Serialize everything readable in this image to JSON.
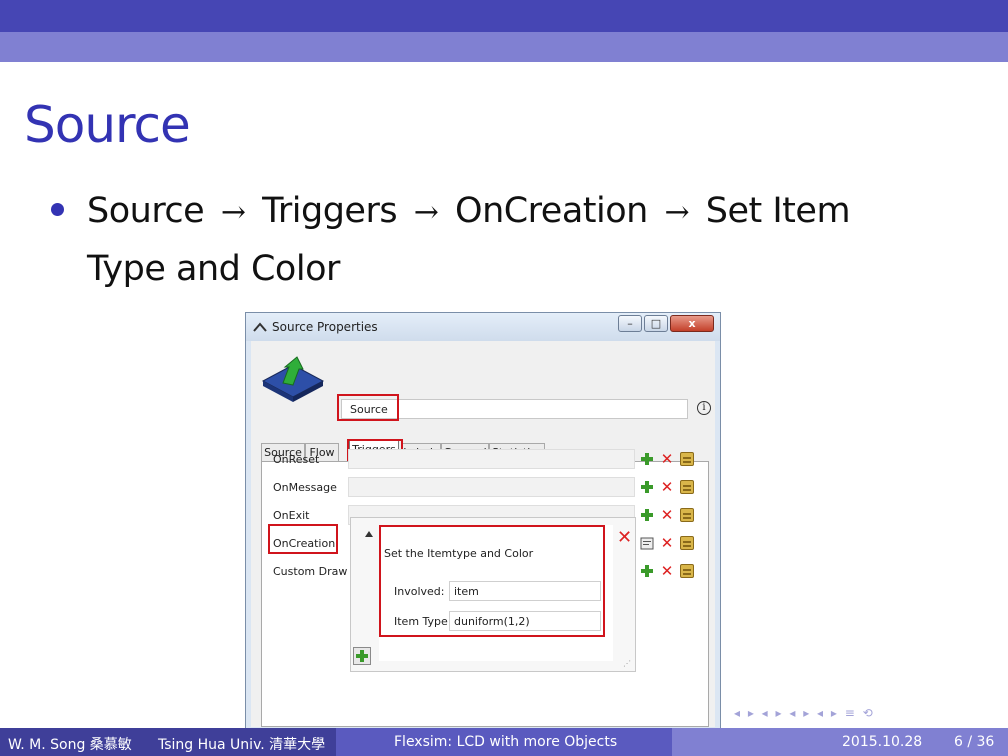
{
  "slide": {
    "title": "Source",
    "bullet": {
      "part1": "Source",
      "part2": "Triggers",
      "part3": "OnCreation",
      "part4": "Set Item",
      "part5": "Type and Color",
      "arrow": "→"
    }
  },
  "window": {
    "title": "Source  Properties",
    "controls": {
      "minimize": "–",
      "maximize": "□",
      "close": "x"
    },
    "name_value": "Source",
    "info": "i",
    "tabs": [
      "Source",
      "Flow",
      "Triggers",
      "Labels",
      "General",
      "Statistics"
    ],
    "active_tab": "Triggers",
    "triggers": [
      "OnReset",
      "OnMessage",
      "OnExit",
      "OnCreation",
      "Custom Draw"
    ],
    "code": {
      "title": "Set the Itemtype and Color",
      "involved_label": "Involved:",
      "involved_value": "item",
      "itemtype_label": "Item Type:",
      "itemtype_value": "duniform(1,2)"
    }
  },
  "nav_symbols": "◂ ▸ ◂ ▸ ◂ ▸ ◂ ▸ ≡ ⟲",
  "footer": {
    "author": "W. M. Song 桑慕敏",
    "institute": "Tsing Hua Univ. 清華大學",
    "subject": "Flexsim: LCD with more Objects",
    "date": "2015.10.28",
    "page": "6 / 36"
  },
  "colors": {
    "title": "#3333b3",
    "highlight": "#d0141c",
    "topbar_dark": "#4646b4",
    "topbar_light": "#8080d2"
  }
}
